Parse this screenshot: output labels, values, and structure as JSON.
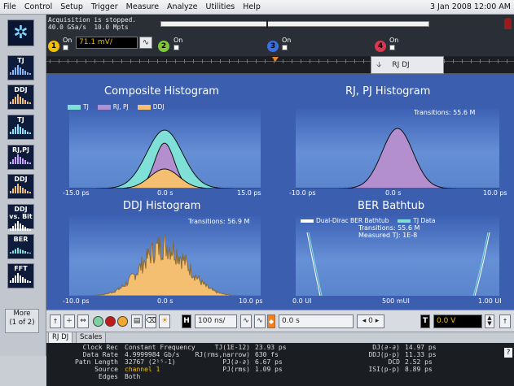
{
  "menu": [
    "File",
    "Control",
    "Setup",
    "Trigger",
    "Measure",
    "Analyze",
    "Utilities",
    "Help"
  ],
  "date": "3 Jan 2008 12:00 AM",
  "status": {
    "line1": "Acquisition is stopped.",
    "line2": "40.0 GSa/s  10.0 Mpts"
  },
  "channels": [
    {
      "num": "1",
      "on": "On",
      "color": "#f0c000"
    },
    {
      "num": "2",
      "on": "On",
      "color": "#7fc63a"
    },
    {
      "num": "3",
      "on": "On",
      "color": "#3b6fe0"
    },
    {
      "num": "4",
      "on": "On",
      "color": "#d9364f"
    }
  ],
  "ch1_scale": "71.1 mV/",
  "jitter_tab": "RJ DJ",
  "left_menu": [
    {
      "label": "TJ",
      "icon": "tj-histogram-icon"
    },
    {
      "label": "DDJ",
      "icon": "ddj-histogram-icon"
    },
    {
      "label": "TJ",
      "icon": "tj-spectrum-icon"
    },
    {
      "label": "RJ,PJ",
      "icon": "rjpj-histogram-icon"
    },
    {
      "label": "DDJ",
      "icon": "ddj-bars-icon"
    },
    {
      "label": "DDJ vs. Bit",
      "icon": "ddj-vs-bit-icon"
    },
    {
      "label": "BER",
      "icon": "ber-bathtub-icon"
    },
    {
      "label": "FFT",
      "icon": "fft-icon"
    }
  ],
  "more": {
    "line1": "More",
    "line2": "(1 of 2)"
  },
  "panels": {
    "composite": {
      "title": "Composite Histogram",
      "legend": [
        "TJ",
        "RJ, PJ",
        "DDJ"
      ],
      "xticks": [
        "-15.0 ps",
        "0.0 s",
        "15.0 ps"
      ]
    },
    "rjpj": {
      "title": "RJ, PJ Histogram",
      "transitions": "Transitions: 55.6 M",
      "xticks": [
        "-10.0 ps",
        "0.0 s",
        "10.0 ps"
      ]
    },
    "ddj": {
      "title": "DDJ Histogram",
      "transitions": "Transitions: 56.9 M",
      "xticks": [
        "-10.0 ps",
        "0.0 s",
        "10.0 ps"
      ]
    },
    "ber": {
      "title": "BER Bathtub",
      "legend": [
        "Dual-Dirac BER Bathtub",
        "TJ Data"
      ],
      "transitions": "Transitions: 55.6 M",
      "measured": "Measured TJ: 1E-8",
      "xticks": [
        "0.0 UI",
        "500 mUI",
        "1.00 UI"
      ]
    }
  },
  "colors": {
    "tj": "#7fe0d8",
    "rjpj": "#b48fcf",
    "ddj": "#f5bf72",
    "hist_outline": "#101010"
  },
  "toolbar": {
    "timebase": "100 ns/",
    "delay": "0.0 s",
    "trig": "0.0 V",
    "h": "H",
    "t": "T"
  },
  "tabs": [
    "RJ DJ",
    "Scales"
  ],
  "measurements": {
    "col1": [
      {
        "label": "Clock Rec",
        "value": "Constant Frequency"
      },
      {
        "label": "Data Rate",
        "value": "4.9999984 Gb/s"
      },
      {
        "label": "Patn Length",
        "value": "32767 (2¹⁵-1)"
      },
      {
        "label": "Source",
        "value": "channel 1"
      },
      {
        "label": "Edges",
        "value": "Both"
      }
    ],
    "col2": [
      {
        "label": "TJ(1E-12)",
        "value": "23.93 ps"
      },
      {
        "label": "RJ(rms,narrow)",
        "value": "630 fs"
      },
      {
        "label": "PJ(∂-∂)",
        "value": "6.67 ps"
      },
      {
        "label": "PJ(rms)",
        "value": "1.09 ps"
      }
    ],
    "col3": [
      {
        "label": "DJ(∂-∂)",
        "value": "14.97 ps"
      },
      {
        "label": "DDJ(p-p)",
        "value": "11.33 ps"
      },
      {
        "label": "DCD",
        "value": "2.52 ps"
      },
      {
        "label": "ISI(p-p)",
        "value": "8.89 ps"
      }
    ]
  },
  "help": "?"
}
